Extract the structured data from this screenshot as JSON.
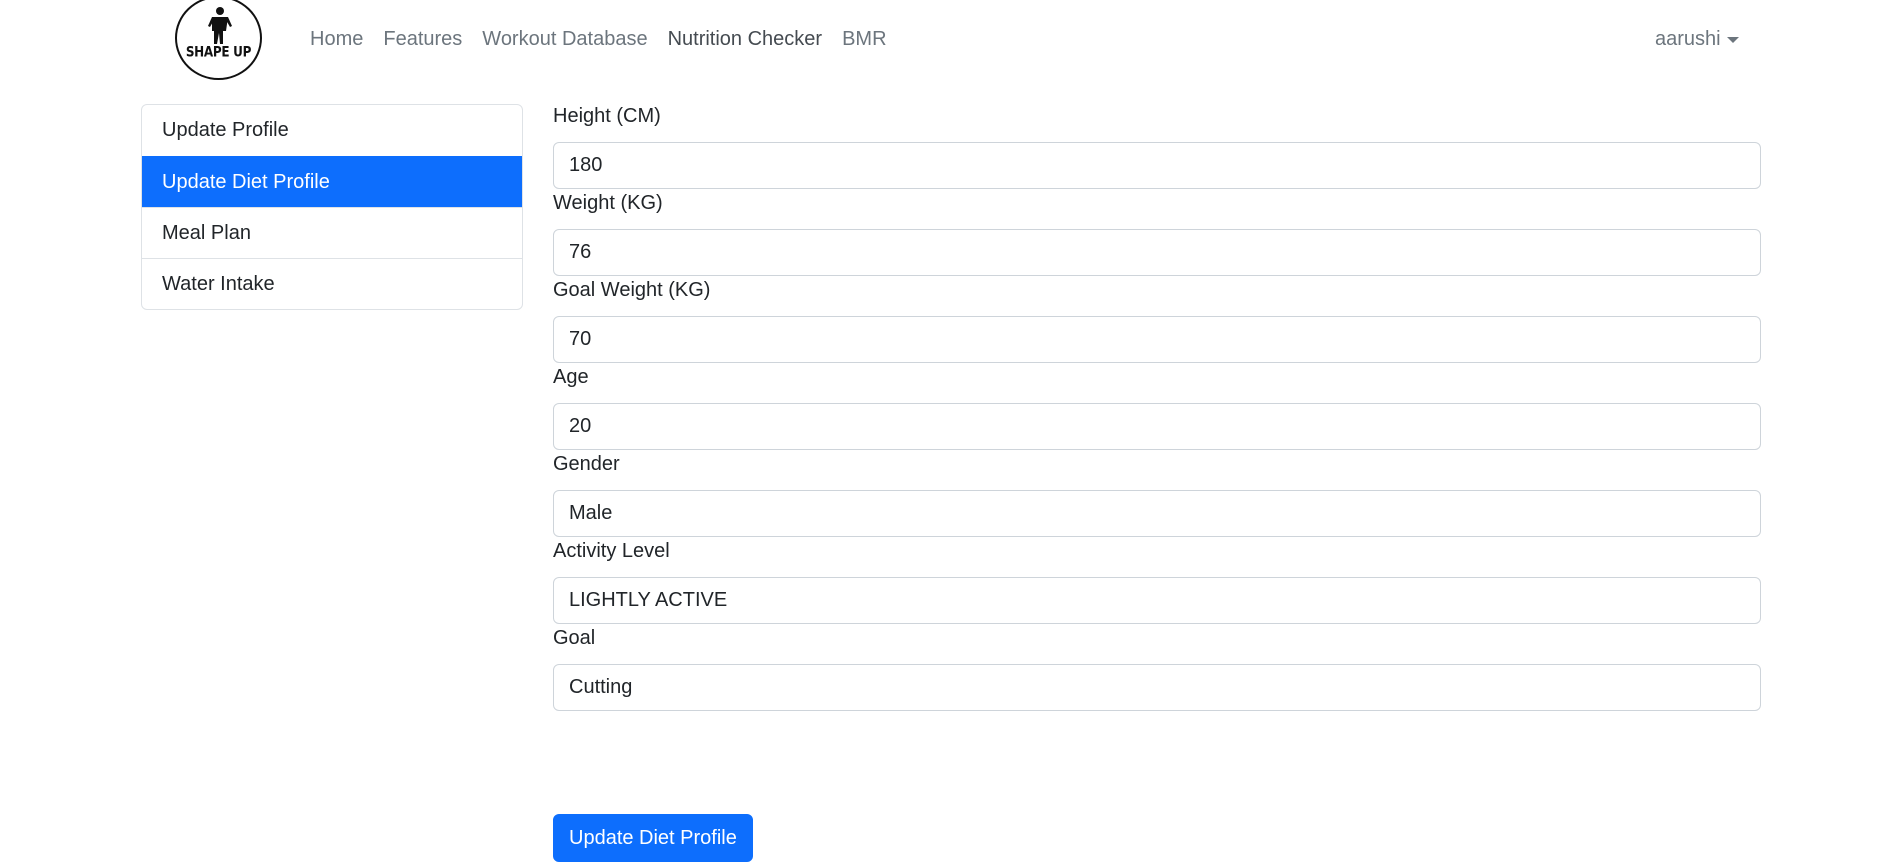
{
  "brand": {
    "logo_text": "SHAPE UP",
    "logo_icon": "running-figure-icon"
  },
  "nav": {
    "links": [
      {
        "label": "Home"
      },
      {
        "label": "Features"
      },
      {
        "label": "Workout Database"
      },
      {
        "label": "Nutrition Checker"
      },
      {
        "label": "BMR"
      }
    ],
    "user": "aarushi"
  },
  "sidebar": {
    "items": [
      {
        "label": "Update Profile"
      },
      {
        "label": "Update Diet Profile"
      },
      {
        "label": "Meal Plan"
      },
      {
        "label": "Water Intake"
      }
    ],
    "active_index": 1
  },
  "form": {
    "fields": [
      {
        "label": "Height (CM)",
        "value": "180"
      },
      {
        "label": "Weight (KG)",
        "value": "76"
      },
      {
        "label": "Goal Weight (KG)",
        "value": "70"
      },
      {
        "label": "Age",
        "value": "20"
      },
      {
        "label": "Gender",
        "value": "Male"
      },
      {
        "label": "Activity Level",
        "value": "LIGHTLY ACTIVE"
      },
      {
        "label": "Goal",
        "value": "Cutting"
      }
    ],
    "submit_label": "Update Diet Profile"
  },
  "colors": {
    "primary": "#0d6efd",
    "nav_text": "#6c757d",
    "nav_active_text": "#454b51",
    "border": "#dee2e6"
  }
}
